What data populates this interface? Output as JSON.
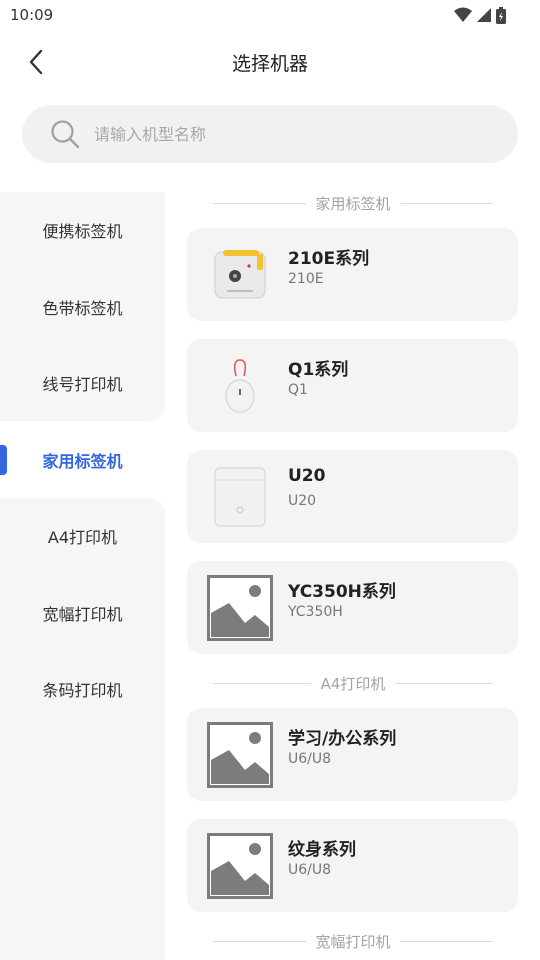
{
  "status_bar": {
    "time": "10:09"
  },
  "header": {
    "title": "选择机器"
  },
  "search": {
    "placeholder": "请输入机型名称"
  },
  "sidebar": {
    "items": [
      {
        "label": "便携标签机"
      },
      {
        "label": "色带标签机"
      },
      {
        "label": "线号打印机"
      },
      {
        "label": "家用标签机",
        "active": true
      },
      {
        "label": "A4打印机"
      },
      {
        "label": "宽幅打印机"
      },
      {
        "label": "条码打印机"
      }
    ]
  },
  "sections": [
    {
      "title": "家用标签机",
      "devices": [
        {
          "name": "210E系列",
          "model": "210E",
          "icon": "label-printer-210e"
        },
        {
          "name": "Q1系列",
          "model": "Q1",
          "icon": "egg-printer-q1"
        },
        {
          "name": "U20",
          "model": "U20",
          "icon": "box-printer-u20"
        },
        {
          "name": "YC350H系列",
          "model": "YC350H",
          "icon": "image-placeholder-icon"
        }
      ]
    },
    {
      "title": "A4打印机",
      "devices": [
        {
          "name": "学习/办公系列",
          "model": "U6/U8",
          "icon": "image-placeholder-icon"
        },
        {
          "name": "纹身系列",
          "model": "U6/U8",
          "icon": "image-placeholder-icon"
        }
      ]
    },
    {
      "title": "宽幅打印机",
      "devices": []
    }
  ],
  "colors": {
    "accent": "#3366e0",
    "card_bg": "#f4f4f4",
    "sidebar_bg": "#f6f6f6"
  }
}
